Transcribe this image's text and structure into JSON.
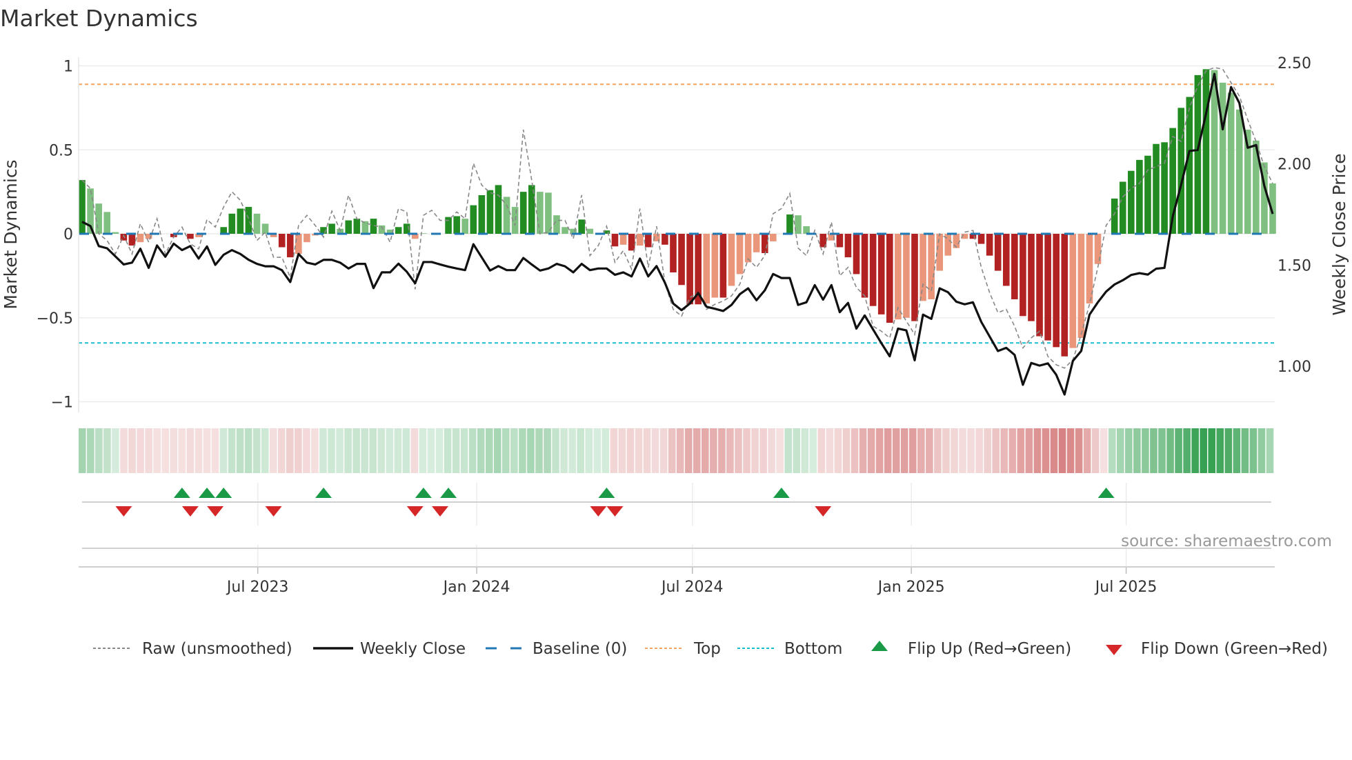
{
  "title": "Market Dynamics",
  "source": "source: sharemaestro.com",
  "chart_data": {
    "type": "bar",
    "title": "Market Dynamics",
    "ylabel": "Market Dynamics",
    "ylabel_right": "Weekly Close Price",
    "xlabel": "",
    "ylim": [
      -1.06,
      1.05
    ],
    "y2lim": [
      0.82,
      2.54
    ],
    "grid": true,
    "legend_placement": "bottom",
    "yticks": [
      {
        "v": 1,
        "label": "1"
      },
      {
        "v": 0.5,
        "label": "0.5"
      },
      {
        "v": 0,
        "label": "0"
      },
      {
        "v": -0.5,
        "label": "−0.5"
      },
      {
        "v": -1,
        "label": "−1"
      }
    ],
    "y2ticks": [
      {
        "v": 2.5,
        "label": "2.50"
      },
      {
        "v": 2.0,
        "label": "2.00"
      },
      {
        "v": 1.5,
        "label": "1.50"
      },
      {
        "v": 1.0,
        "label": "1.00"
      }
    ],
    "xticks": [
      {
        "index": 21.1,
        "label": "Jul 2023"
      },
      {
        "index": 47.4,
        "label": "Jan 2024"
      },
      {
        "index": 73.3,
        "label": "Jul 2024"
      },
      {
        "index": 99.6,
        "label": "Jan 2025"
      },
      {
        "index": 125.4,
        "label": "Jul 2025"
      }
    ],
    "top": 0.89,
    "bottom": -0.65,
    "baseline": 0,
    "values": [
      0.32,
      0.27,
      0.18,
      0.13,
      0.01,
      -0.04,
      -0.07,
      -0.05,
      -0.03,
      0,
      0,
      -0.02,
      0,
      -0.03,
      -0.02,
      0,
      0,
      0.04,
      0.12,
      0.15,
      0.16,
      0.12,
      0.06,
      -0.02,
      -0.08,
      -0.14,
      -0.12,
      -0.05,
      -0.01,
      0.04,
      0.06,
      0.03,
      0.08,
      0.09,
      0.075,
      0.09,
      0.05,
      0.025,
      0.04,
      0.06,
      -0.03,
      0.003,
      0,
      0,
      0.1,
      0.105,
      0.09,
      0.17,
      0.23,
      0.26,
      0.29,
      0.22,
      0.16,
      0.25,
      0.29,
      0.25,
      0.245,
      0.11,
      0.04,
      0.03,
      0.085,
      0.03,
      0,
      0.02,
      -0.075,
      -0.065,
      -0.1,
      -0.07,
      -0.08,
      -0.045,
      -0.065,
      -0.23,
      -0.305,
      -0.42,
      -0.42,
      -0.415,
      -0.38,
      -0.38,
      -0.31,
      -0.24,
      -0.17,
      -0.11,
      -0.115,
      -0.045,
      0,
      0.115,
      0.11,
      0.045,
      0,
      -0.08,
      -0.04,
      -0.08,
      -0.14,
      -0.24,
      -0.38,
      -0.43,
      -0.48,
      -0.53,
      -0.51,
      -0.5,
      -0.52,
      -0.4,
      -0.39,
      -0.22,
      -0.13,
      -0.085,
      -0.03,
      -0.03,
      -0.06,
      -0.13,
      -0.22,
      -0.31,
      -0.39,
      -0.49,
      -0.52,
      -0.61,
      -0.635,
      -0.675,
      -0.73,
      -0.68,
      -0.62,
      -0.415,
      -0.18,
      0,
      0.21,
      0.31,
      0.375,
      0.44,
      0.465,
      0.535,
      0.545,
      0.63,
      0.75,
      0.815,
      0.945,
      0.98,
      0.975,
      0.9,
      0.84,
      0.74,
      0.62,
      0.555,
      0.425,
      0.3
    ],
    "raw": [
      0.32,
      0.27,
      0,
      -0.04,
      -0.12,
      -0.01,
      -0.12,
      0.06,
      -0.05,
      0.09,
      -0.12,
      -0.02,
      0.04,
      -0.06,
      -0.09,
      0.085,
      0.04,
      0.16,
      0.25,
      0.2,
      0.09,
      -0.04,
      0.01,
      -0.14,
      -0.14,
      -0.26,
      0.05,
      0.11,
      0.05,
      -0.02,
      0.135,
      0.02,
      0.23,
      0.09,
      0.065,
      0.05,
      0.04,
      -0.05,
      0.15,
      0.13,
      -0.33,
      0.11,
      0.14,
      0.08,
      0.08,
      0.13,
      0.09,
      0.42,
      0.29,
      0.245,
      0.23,
      0.17,
      0.05,
      0.62,
      0.32,
      0,
      0.01,
      0.08,
      0.08,
      -0.03,
      0.23,
      -0.13,
      -0.07,
      0.045,
      -0.17,
      -0.1,
      -0.21,
      0.15,
      -0.2,
      0.045,
      -0.29,
      -0.45,
      -0.49,
      -0.38,
      -0.35,
      -0.45,
      -0.42,
      -0.4,
      -0.37,
      -0.3,
      -0.15,
      -0.2,
      -0.13,
      0.12,
      0.15,
      0.24,
      -0.085,
      -0.13,
      0.02,
      -0.12,
      0.07,
      -0.25,
      -0.2,
      -0.32,
      -0.37,
      -0.55,
      -0.58,
      -0.62,
      -0.44,
      -0.52,
      -0.6,
      -0.3,
      -0.34,
      0,
      -0.03,
      -0.08,
      0.01,
      0.02,
      -0.2,
      -0.35,
      -0.47,
      -0.45,
      -0.55,
      -0.68,
      -0.62,
      -0.58,
      -0.73,
      -0.78,
      -0.8,
      -0.75,
      -0.6,
      -0.42,
      -0.2,
      0.05,
      0.12,
      0.22,
      0.27,
      0.3,
      0.38,
      0.4,
      0.42,
      0.58,
      0.55,
      0.75,
      0.88,
      0.97,
      0.99,
      0.98,
      0.9,
      0.82,
      0.68,
      0.55,
      0.4,
      0.3
    ],
    "close": [
      1.714,
      1.693,
      1.594,
      1.583,
      1.543,
      1.503,
      1.512,
      1.581,
      1.486,
      1.597,
      1.541,
      1.606,
      1.574,
      1.594,
      1.532,
      1.592,
      1.501,
      1.551,
      1.574,
      1.555,
      1.526,
      1.506,
      1.494,
      1.494,
      1.475,
      1.416,
      1.555,
      1.512,
      1.503,
      1.526,
      1.526,
      1.512,
      1.483,
      1.506,
      1.506,
      1.386,
      1.464,
      1.464,
      1.507,
      1.467,
      1.41,
      1.515,
      1.515,
      1.503,
      1.492,
      1.483,
      1.475,
      1.603,
      1.538,
      1.473,
      1.495,
      1.475,
      1.475,
      1.535,
      1.503,
      1.473,
      1.483,
      1.506,
      1.494,
      1.464,
      1.506,
      1.475,
      1.483,
      1.483,
      1.452,
      1.464,
      1.444,
      1.532,
      1.444,
      1.495,
      1.413,
      1.31,
      1.277,
      1.31,
      1.362,
      1.294,
      1.284,
      1.273,
      1.303,
      1.356,
      1.385,
      1.326,
      1.375,
      1.456,
      1.436,
      1.436,
      1.303,
      1.316,
      1.401,
      1.329,
      1.401,
      1.267,
      1.313,
      1.186,
      1.251,
      1.182,
      1.114,
      1.049,
      1.186,
      1.177,
      1.029,
      1.255,
      1.234,
      1.385,
      1.366,
      1.319,
      1.306,
      1.316,
      1.219,
      1.147,
      1.075,
      1.091,
      1.056,
      0.908,
      1.016,
      1.003,
      1.014,
      0.958,
      0.86,
      1.026,
      1.075,
      1.255,
      1.316,
      1.369,
      1.404,
      1.425,
      1.451,
      1.46,
      1.453,
      1.482,
      1.486,
      1.741,
      1.897,
      2.064,
      2.069,
      2.249,
      2.445,
      2.171,
      2.38,
      2.301,
      2.08,
      2.093,
      1.891,
      1.753
    ],
    "flip_up": [
      12,
      15,
      17,
      29,
      41,
      44,
      63,
      84,
      123
    ],
    "flip_down": [
      5,
      13,
      16,
      23,
      40,
      43,
      62,
      64,
      89
    ],
    "legend": [
      {
        "key": "raw",
        "label": "Raw (unsmoothed)"
      },
      {
        "key": "close",
        "label": "Weekly Close"
      },
      {
        "key": "baseline",
        "label": "Baseline (0)"
      },
      {
        "key": "top",
        "label": "Top"
      },
      {
        "key": "bottom",
        "label": "Bottom"
      },
      {
        "key": "flip_up",
        "label": "Flip Up (Red→Green)"
      },
      {
        "key": "flip_down",
        "label": "Flip Down (Green→Red)"
      }
    ],
    "colors": {
      "bar_pos_strong": "#228b22",
      "bar_pos_weak": "#7fbf7f",
      "bar_neg_strong": "#b22222",
      "bar_neg_weak": "#e9967a",
      "raw": "#888888",
      "close": "#111111",
      "baseline": "#1f77b4",
      "top": "#f4a460",
      "bottom": "#17becf",
      "flip_up": "#1a9a47",
      "flip_down": "#d62728"
    }
  }
}
